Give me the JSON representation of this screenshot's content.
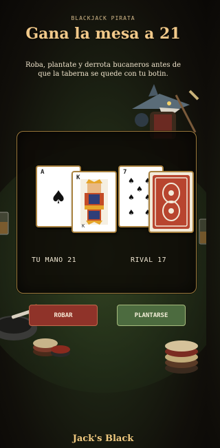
{
  "header": {
    "eyebrow": "BLACKJACK PIRATA",
    "title": "Gana la mesa a 21",
    "subtitle": "Roba, plantate y derrota bucaneros antes de que la taberna se quede con tu botin."
  },
  "game": {
    "player_cards": [
      {
        "rank": "A",
        "suit": "spades",
        "suit_glyph": "♠"
      },
      {
        "rank": "K",
        "suit": "spades",
        "suit_glyph": "♠"
      }
    ],
    "rival_cards": [
      {
        "rank": "7",
        "suit": "spades",
        "suit_glyph": "♠"
      },
      {
        "rank": "",
        "face_down": true
      }
    ],
    "player_score_label": "TU MANO 21",
    "rival_score_label": "RIVAL 17"
  },
  "actions": {
    "draw_label": "ROBAR",
    "stand_label": "PLANTARSE"
  },
  "footer": {
    "brand": "Jack's Black"
  },
  "colors": {
    "accent_gold": "#f1c98a",
    "draw_button": "#8f3329",
    "stand_button": "#4c6b3f",
    "card_back": "#b8452f"
  },
  "icons": [
    "shark-pirate-icon",
    "poker-chips-icon",
    "ashtray-icon",
    "whisky-glass-icon",
    "spade-icon",
    "king-icon"
  ]
}
